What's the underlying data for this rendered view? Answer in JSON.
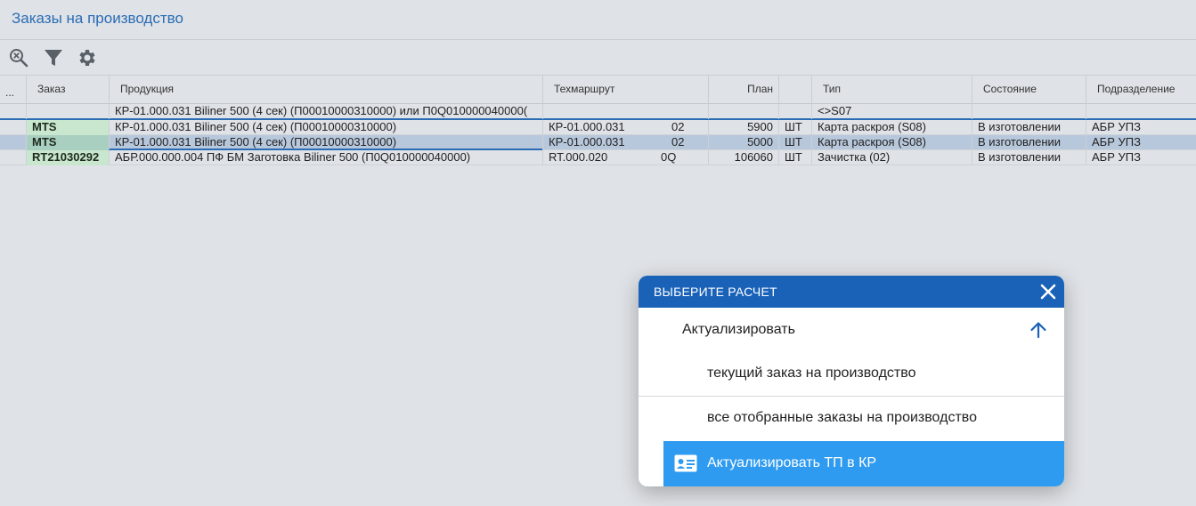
{
  "page": {
    "title": "Заказы на производство"
  },
  "toolbar": {
    "icons": [
      "clear-filter-icon",
      "filter-icon",
      "gear-icon"
    ]
  },
  "grid": {
    "corner": "...",
    "columns": {
      "order": "Заказ",
      "product": "Продукция",
      "route": "Техмаршрут",
      "plan": "План",
      "type": "Тип",
      "state": "Состояние",
      "dept": "Подразделение"
    },
    "filter": {
      "product": "КР-01.000.031 Biliner 500 (4 сек) (П00010000310000) или П0Q010000040000(",
      "type": "<>S07"
    },
    "rows": [
      {
        "order": "MTS",
        "product": "КР-01.000.031 Biliner 500 (4 сек) (П00010000310000)",
        "route": "КР-01.000.031",
        "route_op": "02",
        "plan": "5900",
        "unit": "ШТ",
        "type": "Карта раскроя (S08)",
        "state": "В изготовлении",
        "dept": "АБР УПЗ"
      },
      {
        "order": "MTS",
        "product": "КР-01.000.031 Biliner 500 (4 сек) (П00010000310000)",
        "route": "КР-01.000.031",
        "route_op": "02",
        "plan": "5000",
        "unit": "ШТ",
        "type": "Карта раскроя (S08)",
        "state": "В изготовлении",
        "dept": "АБР УПЗ"
      },
      {
        "order": "RT21030292",
        "product": "АБР.000.000.004 ПФ БМ Заготовка Biliner 500 (П0Q010000040000)",
        "route": "RT.000.020",
        "route_op": "0Q",
        "plan": "106060",
        "unit": "ШТ",
        "type": "Зачистка (02)",
        "state": "В изготовлении",
        "dept": "АБР УПЗ"
      }
    ]
  },
  "dialog": {
    "title": "ВЫБЕРИТЕ РАСЧЕТ",
    "group_label": "Актуализировать",
    "option_current": "текущий заказ на производство",
    "option_all": "все отобранные заказы на производство",
    "action_label": "Актуализировать ТП в КР",
    "accent": "#1a62b8",
    "highlight": "#2f9bf0"
  }
}
